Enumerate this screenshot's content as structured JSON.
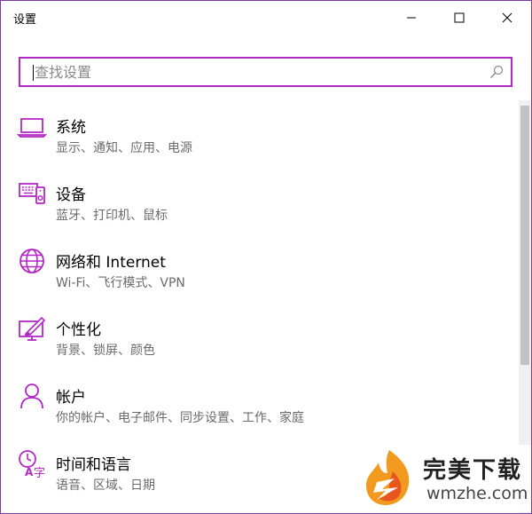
{
  "window": {
    "title": "设置",
    "controls": {
      "minimize": "minimize-icon",
      "maximize": "maximize-icon",
      "close": "close-icon"
    }
  },
  "search": {
    "value": "",
    "placeholder": "查找设置",
    "icon": "search-icon"
  },
  "accent_color": "#b426c6",
  "settings": [
    {
      "title": "系统",
      "desc": "显示、通知、应用、电源",
      "icon": "laptop-icon"
    },
    {
      "title": "设备",
      "desc": "蓝牙、打印机、鼠标",
      "icon": "devices-icon"
    },
    {
      "title": "网络和 Internet",
      "desc": "Wi-Fi、飞行模式、VPN",
      "icon": "globe-icon"
    },
    {
      "title": "个性化",
      "desc": "背景、锁屏、颜色",
      "icon": "personalization-icon"
    },
    {
      "title": "帐户",
      "desc": "你的帐户、电子邮件、同步设置、工作、家庭",
      "icon": "person-icon"
    },
    {
      "title": "时间和语言",
      "desc": "语音、区域、日期",
      "icon": "time-language-icon"
    }
  ],
  "watermark": {
    "title": "完美下载",
    "url": "wmzhe.com"
  }
}
